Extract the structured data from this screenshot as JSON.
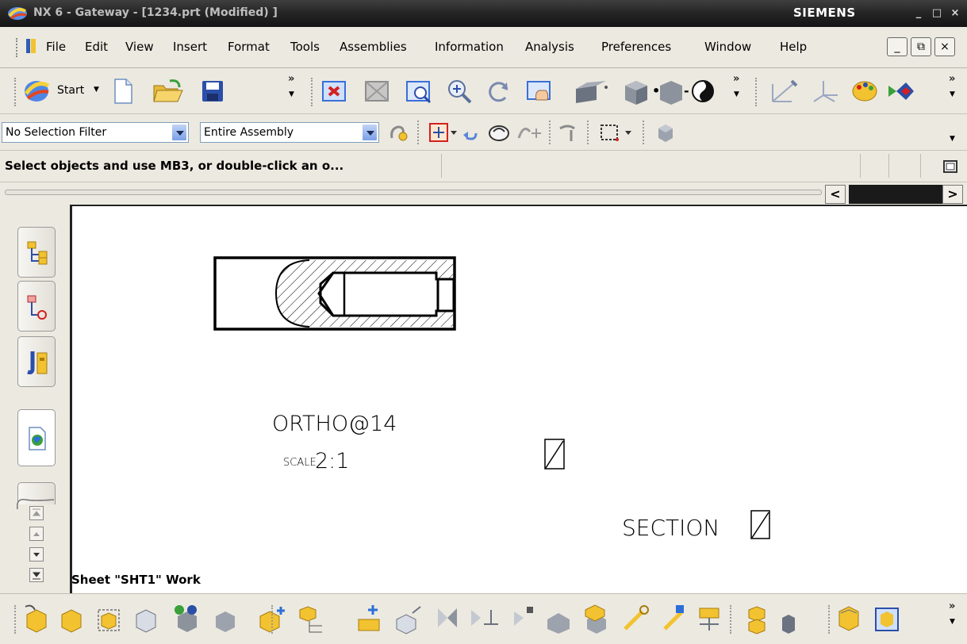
{
  "window": {
    "title": "NX 6 - Gateway - [1234.prt (Modified) ]",
    "brand": "SIEMENS",
    "controls": [
      "_",
      "□",
      "×"
    ]
  },
  "menubar": {
    "items": [
      "File",
      "Edit",
      "View",
      "Insert",
      "Format",
      "Tools",
      "Assemblies",
      "Information",
      "Analysis",
      "Preferences",
      "Window",
      "Help"
    ],
    "mdi_controls": [
      "_",
      "⧉",
      "×"
    ]
  },
  "toolbar_standard": {
    "start_label": "Start",
    "more_glyph": "»"
  },
  "selection_bar": {
    "filter_value": "No Selection Filter",
    "scope_value": "Entire Assembly"
  },
  "cue_line": {
    "text": "Select objects and use MB3, or double-click an o..."
  },
  "scroll": {
    "left_glyph": "<",
    "right_glyph": ">"
  },
  "drawing": {
    "view_label": "ORTHO@14",
    "scale_prefix": "SCALE",
    "scale_value": "2:1",
    "section_label": "SECTION"
  },
  "status": {
    "text": "Sheet \"SHT1\" Work"
  },
  "colors": {
    "titlebar": "#262626",
    "chrome": "#ece9e0",
    "accent_blue": "#3a6fd8",
    "accent_yellow": "#f2c230"
  },
  "icons": {
    "toolbar_standard": [
      "new-file-icon",
      "open-folder-icon",
      "save-icon",
      "fit-view-icon",
      "zoom-area-icon",
      "zoom-in-icon",
      "rotate-icon",
      "pan-icon",
      "shaded-box-icon",
      "render-style-icon",
      "orient-view-icon",
      "wcs-icon",
      "palette-icon",
      "visualization-icon"
    ],
    "toolbar_selection": [
      "filter-settings-icon",
      "snap-point-icon",
      "undo-select-icon",
      "eraser-icon",
      "curve-rule-icon",
      "select-rectangle-icon",
      "body-select-icon"
    ],
    "toolbar_assembly": [
      "component-icon",
      "add-component-icon",
      "select-component-icon",
      "clone-icon",
      "camera-component-icon",
      "hidden-component-icon",
      "new-component-icon",
      "new-parent-icon",
      "add-existing-icon",
      "move-component-icon",
      "mirror-icon",
      "constraint-icon",
      "explode-icon",
      "sequence-icon",
      "replace-icon",
      "wave-link-icon",
      "wave-geometry-icon",
      "arrangement-icon",
      "sets-icon",
      "reference-set-icon",
      "window-icon"
    ]
  }
}
